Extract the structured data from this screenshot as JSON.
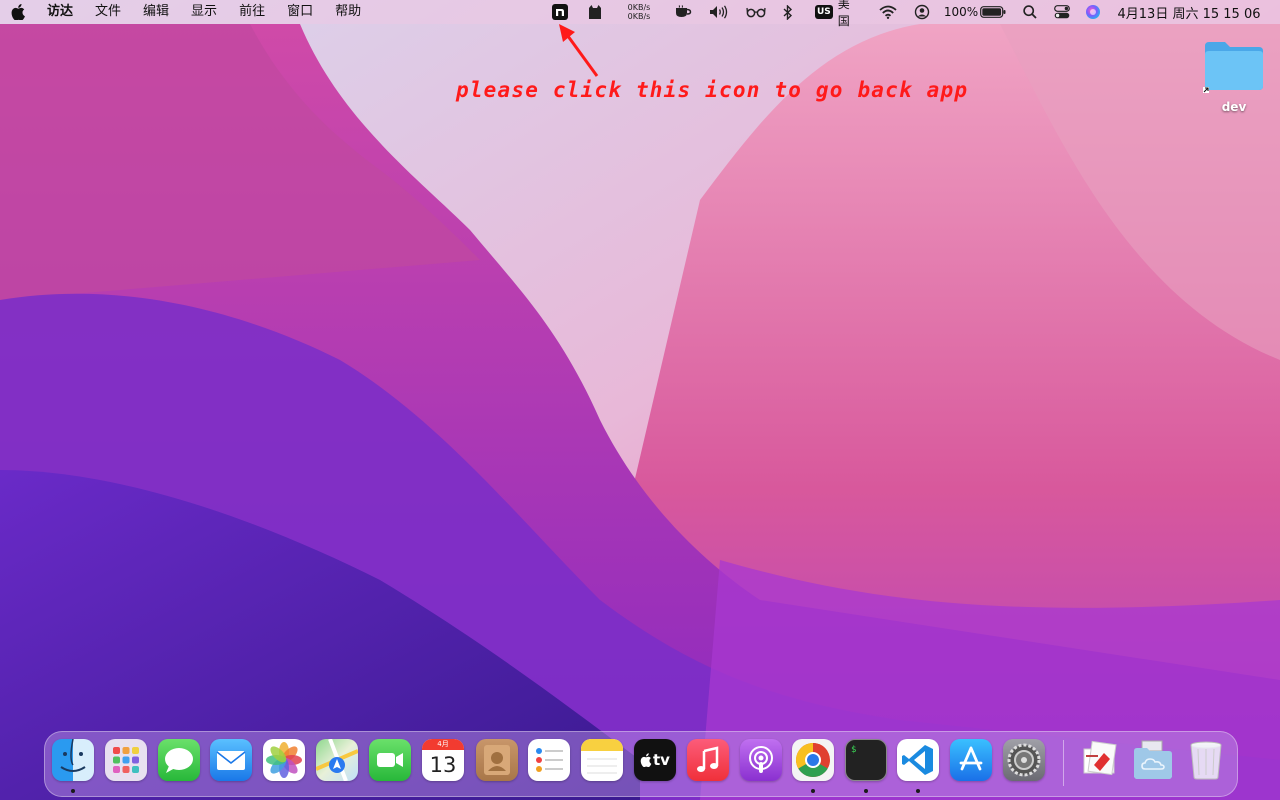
{
  "menubar": {
    "app_name": "访达",
    "menus": [
      "文件",
      "编辑",
      "显示",
      "前往",
      "窗口",
      "帮助"
    ],
    "netspeed_up": "0KB/s",
    "netspeed_down": "0KB/s",
    "input_badge": "US",
    "input_label": "美国",
    "battery": "100%",
    "clock": "4月13日 周六  15 15 06"
  },
  "annotation": {
    "text": "please click this icon to go back app",
    "color": "#ff1a1a"
  },
  "desktop": {
    "folder_label": "dev"
  },
  "dock": {
    "calendar_month": "4月",
    "calendar_day": "13",
    "tv_label": "tv",
    "terminal_prompt": "$",
    "apps": [
      "finder",
      "launchpad",
      "messages",
      "mail",
      "photos",
      "maps",
      "facetime",
      "calendar",
      "contacts",
      "reminders",
      "notes",
      "tv",
      "music",
      "podcasts",
      "chrome",
      "terminal",
      "vscode",
      "app-store",
      "system-preferences",
      "preview-docs",
      "icloud-folder",
      "trash"
    ],
    "running": [
      "finder",
      "chrome",
      "terminal",
      "vscode"
    ]
  },
  "colors": {
    "accent_red": "#ff1a1a",
    "dock_bg": "rgba(190,150,230,0.45)"
  }
}
